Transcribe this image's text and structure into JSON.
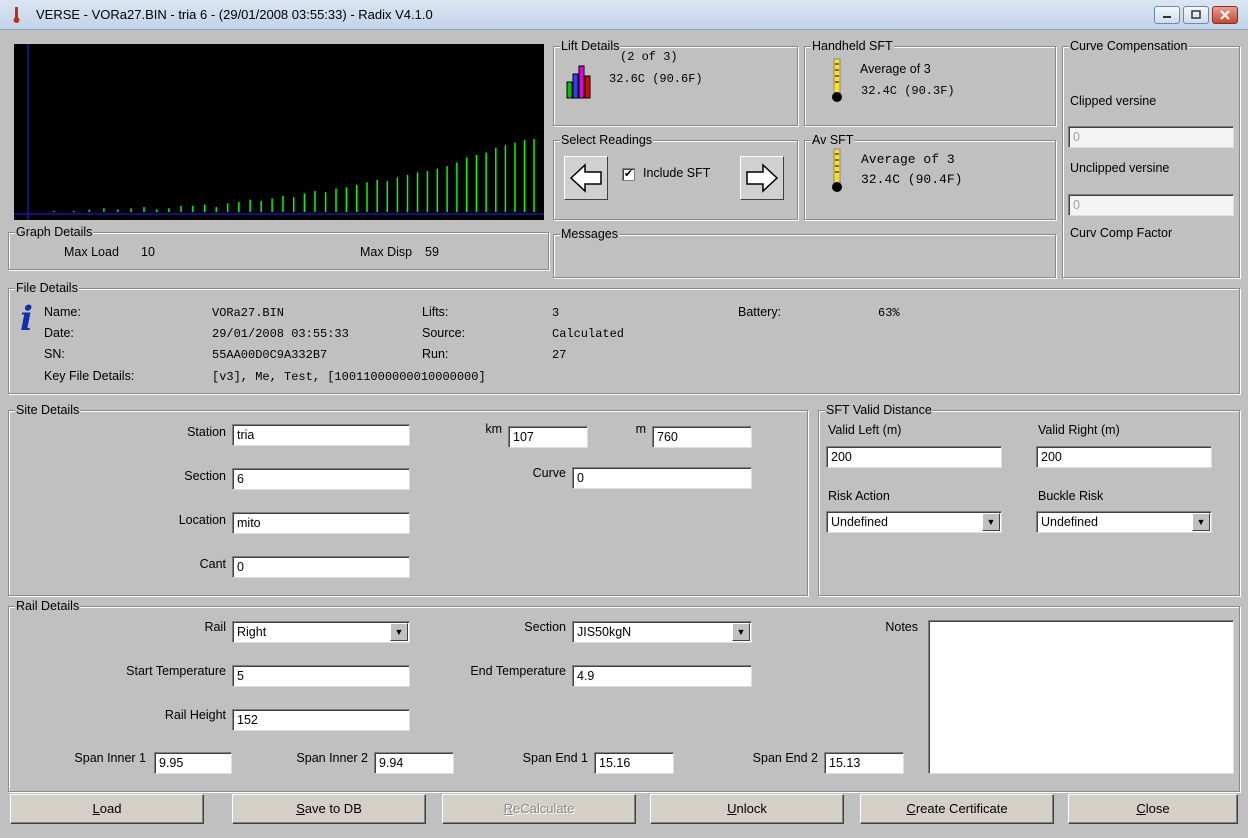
{
  "window": {
    "title": "VERSE - VORa27.BIN - tria 6 - (29/01/2008 03:55:33) - Radix V4.1.0"
  },
  "graph": {
    "legend": "Graph Details",
    "max_load_label": "Max Load",
    "max_load": "10",
    "max_disp_label": "Max Disp",
    "max_disp": "59",
    "bar_heights": [
      1,
      1,
      2,
      3,
      2,
      3,
      4,
      2,
      3,
      5,
      5,
      6,
      4,
      7,
      8,
      10,
      9,
      11,
      13,
      12,
      15,
      17,
      16,
      19,
      20,
      22,
      24,
      26,
      25,
      28,
      30,
      32,
      33,
      35,
      37,
      40,
      44,
      46,
      48,
      52,
      54,
      56,
      58,
      59
    ]
  },
  "lift": {
    "legend": "Lift Details",
    "count": "(2 of 3)",
    "temp": "32.6C (90.6F)"
  },
  "handheld": {
    "legend": "Handheld SFT",
    "average": "Average of 3",
    "temp": "32.4C (90.3F)"
  },
  "select": {
    "legend": "Select Readings",
    "include_sft_label": "Include SFT",
    "include_sft_checked": true
  },
  "avsft": {
    "legend": "Av SFT",
    "average": "Average of 3",
    "temp": "32.4C (90.4F)"
  },
  "messages": {
    "legend": "Messages"
  },
  "curve": {
    "legend": "Curve Compensation",
    "clipped_label": "Clipped versine",
    "clipped_value": "0",
    "unclipped_label": "Unclipped versine",
    "unclipped_value": "0",
    "factor_label": "Curv Comp Factor"
  },
  "file": {
    "legend": "File Details",
    "name_label": "Name:",
    "name": "VORa27.BIN",
    "date_label": "Date:",
    "date": "29/01/2008 03:55:33",
    "sn_label": "SN:",
    "sn": "55AA00D0C9A332B7",
    "key_label": "Key File Details:",
    "key": "[v3], Me, Test, [10011000000010000000]",
    "lifts_label": "Lifts:",
    "lifts": "3",
    "source_label": "Source:",
    "source": "Calculated",
    "run_label": "Run:",
    "run": "27",
    "battery_label": "Battery:",
    "battery": "63%"
  },
  "site": {
    "legend": "Site Details",
    "station_label": "Station",
    "station": "tria",
    "section_label": "Section",
    "section": "6",
    "location_label": "Location",
    "location": "mito",
    "cant_label": "Cant",
    "cant": "0",
    "km_label": "km",
    "km": "107",
    "m_label": "m",
    "m": "760",
    "curve_label": "Curve",
    "curve": "0"
  },
  "sftvalid": {
    "legend": "SFT Valid Distance",
    "left_label": "Valid Left (m)",
    "left": "200",
    "right_label": "Valid Right (m)",
    "right": "200",
    "risk_label": "Risk Action",
    "risk": "Undefined",
    "buckle_label": "Buckle Risk",
    "buckle": "Undefined"
  },
  "rail": {
    "legend": "Rail Details",
    "rail_label": "Rail",
    "rail": "Right",
    "section_label": "Section",
    "section": "JIS50kgN",
    "start_label": "Start Temperature",
    "start": "5",
    "end_label": "End Temperature",
    "end": "4.9",
    "height_label": "Rail Height",
    "height": "152",
    "notes_label": "Notes",
    "span_inner1_label": "Span Inner 1",
    "span_inner1": "9.95",
    "span_inner2_label": "Span Inner 2",
    "span_inner2": "9.94",
    "span_end1_label": "Span End 1",
    "span_end1": "15.16",
    "span_end2_label": "Span End 2",
    "span_end2": "15.13"
  },
  "buttons": {
    "load_u": "L",
    "load_rest": "oad",
    "save_u": "S",
    "save_rest": "ave to DB",
    "recalc_u": "R",
    "recalc_rest": "eCalculate",
    "unlock_u": "U",
    "unlock_rest": "nlock",
    "cert_u": "C",
    "cert_rest": "reate Certificate",
    "close_u": "C",
    "close_rest": "lose"
  }
}
